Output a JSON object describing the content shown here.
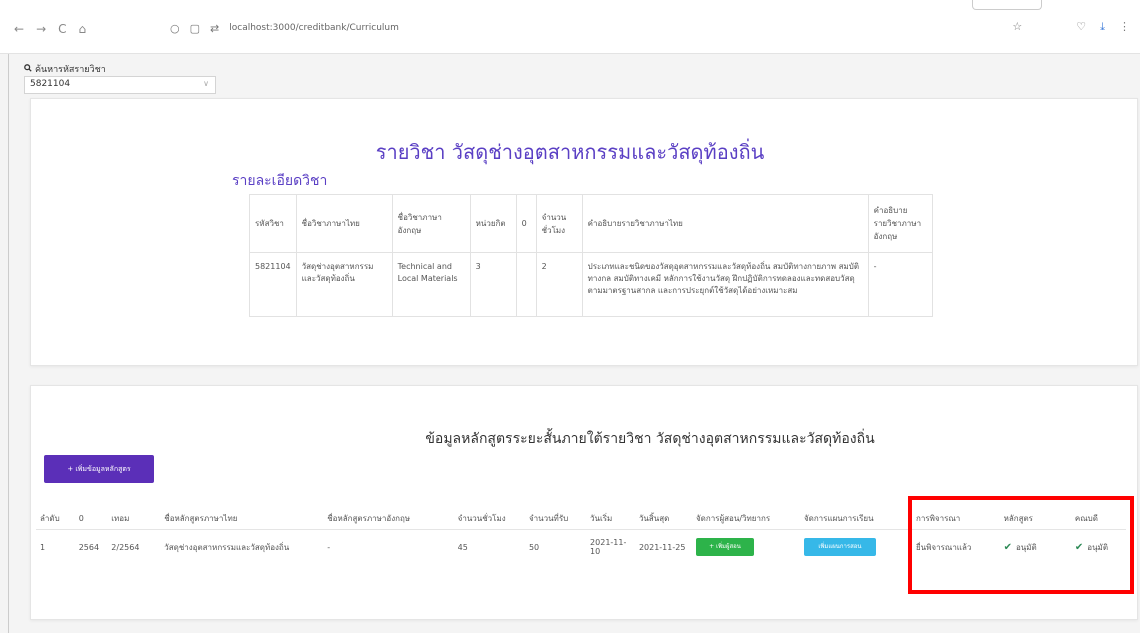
{
  "browser": {
    "back": "←",
    "forward": "→",
    "reload": "C",
    "home": "⌂",
    "url": "localhost:3000/creditbank/Curriculum"
  },
  "search": {
    "label": "ค้นหารหัสรายวิชา",
    "value": "5821104"
  },
  "course": {
    "title": "รายวิชา วัสดุช่างอุตสาหกรรมและวัสดุท้องถิ่น",
    "detail_heading": "รายละเอียดวิชา",
    "columns": [
      "รหัสวิชา",
      "ชื่อวิชาภาษาไทย",
      "ชื่อวิชาภาษาอังกฤษ",
      "หน่วยกิต",
      "0",
      "จำนวนชั่วโมง",
      "คำอธิบายรายวิชาภาษาไทย",
      "คำอธิบายรายวิชาภาษาอังกฤษ"
    ],
    "row": [
      "5821104",
      "วัสดุช่างอุตสาหกรรมและวัสดุท้องถิ่น",
      "Technical and Local Materials",
      "3",
      "",
      "2",
      "ประเภทและชนิดของวัสดุอุตสาหกรรมและวัสดุท้องถิ่น สมบัติทางกายภาพ สมบัติทางกล สมบัติทางเคมี หลักการใช้งานวัสดุ ฝึกปฏิบัติการทดลองและทดสอบวัสดุตามมาตรฐานสากล และการประยุกต์ใช้วัสดุได้อย่างเหมาะสม",
      "-"
    ]
  },
  "short_course": {
    "title": "ข้อมูลหลักสูตรระยะสั้นภายใต้รายวิชา วัสดุช่างอุตสาหกรรมและวัสดุท้องถิ่น",
    "add_button": "+ เพิ่มข้อมูลหลักสูตร",
    "columns": [
      "ลำดับ",
      "0",
      "เทอม",
      "ชื่อหลักสูตรภาษาไทย",
      "ชื่อหลักสูตรภาษาอังกฤษ",
      "จำนวนชั่วโมง",
      "จำนวนที่รับ",
      "วันเริ่ม",
      "วันสิ้นสุด",
      "จัดการผู้สอน/วิทยากร",
      "จัดการแผนการเรียน",
      "การพิจารณา",
      "หลักสูตร",
      "คณบดี"
    ],
    "rows": [
      {
        "no": "1",
        "year": "2564",
        "term": "2/2564",
        "name_th": "วัสดุช่างอุตสาหกรรมและวัสดุท้องถิ่น",
        "name_en": "-",
        "hours": "45",
        "capacity": "50",
        "start": "2021-11-10",
        "end": "2021-11-25",
        "instructor_button": "+ เพิ่มผู้สอน",
        "plan_button": "เพิ่มแผนการสอน",
        "review": "ยื่นพิจารณาแล้ว",
        "curriculum_status": "อนุมัติ",
        "dean_status": "อนุมัติ"
      }
    ]
  },
  "colors": {
    "accent": "#5a3fc4",
    "add_button": "#5b2fb8",
    "green_button": "#2db34a",
    "cyan_button": "#36b8e8",
    "highlight": "#ff0000"
  }
}
